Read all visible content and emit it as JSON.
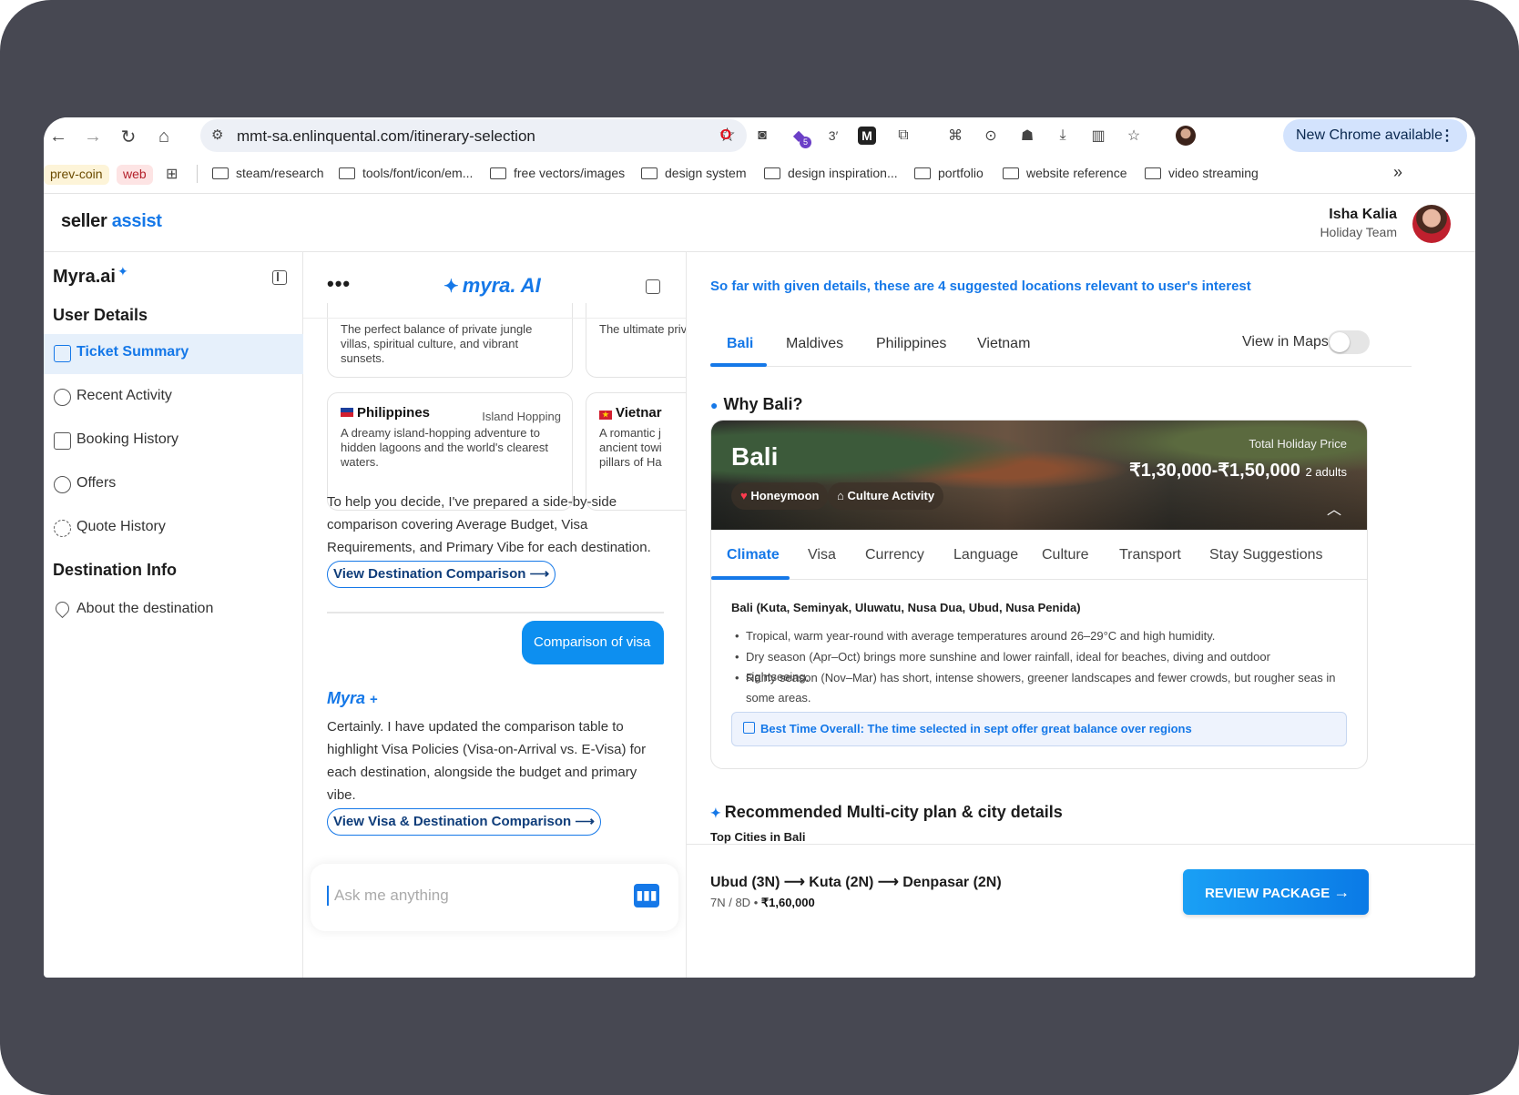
{
  "browser": {
    "url": "mmt-sa.enlinquental.com/itinerary-selection",
    "new_chrome": "New Chrome available",
    "ext_badge": "5",
    "ext_timer": "3′",
    "chips": [
      "prev-coin",
      "web"
    ],
    "bookmarks": [
      "steam/research",
      "tools/font/icon/em...",
      "free vectors/images",
      "design system",
      "design inspiration...",
      "portfolio",
      "website reference",
      "video streaming"
    ],
    "more": "»"
  },
  "app": {
    "logo_seller": "seller",
    "logo_assist": "assist",
    "user_name": "Isha Kalia",
    "user_team": "Holiday Team"
  },
  "sidebar": {
    "title": "Myra.ai",
    "section1": "User Details",
    "items": [
      "Ticket Summary",
      "Recent Activity",
      "Booking History",
      "Offers",
      "Quote History"
    ],
    "section2": "Destination Info",
    "items2": [
      "About the destination"
    ]
  },
  "chat": {
    "brand": "myra. AI",
    "brand_spark": "✦",
    "cards_top": [
      {
        "text": "The perfect balance of private jungle villas, spiritual culture, and vibrant sunsets."
      },
      {
        "text": "The ultimate private over lagoons."
      }
    ],
    "cards": [
      {
        "name": "Philippines",
        "tag": "Island Hopping",
        "text": "A dreamy island-hopping adventure to hidden lagoons and the world's clearest waters."
      },
      {
        "name": "Vietnar",
        "text": "A romantic j ancient towi pillars of Ha"
      }
    ],
    "msg1": "To help you decide, I've prepared a side-by-side comparison covering Average Budget, Visa Requirements, and Primary Vibe for each destination.",
    "link1": "View Destination Comparison ⟶",
    "user_msg": "Comparison of visa",
    "myra_label": "Myra",
    "myra_spark": "+",
    "msg2": "Certainly. I have updated the comparison table to highlight Visa Policies (Visa-on-Arrival vs. E-Visa) for each destination, alongside the budget and primary vibe.",
    "link2": "View Visa & Destination Comparison ⟶",
    "input_placeholder": "Ask me anything"
  },
  "right": {
    "headline": "So far with given details, these are 4 suggested locations relevant to user's interest",
    "tabs": [
      "Bali",
      "Maldives",
      "Philippines",
      "Vietnam"
    ],
    "view_maps": "View in Maps",
    "why": "Why Bali?",
    "hero": {
      "name": "Bali",
      "pill1": "Honeymoon",
      "pill2": "Culture Activity",
      "price_label": "Total Holiday Price",
      "price": "₹1,30,000-₹1,50,000",
      "adults": "2 adults"
    },
    "detail_tabs": [
      "Climate",
      "Visa",
      "Currency",
      "Language",
      "Culture",
      "Transport",
      "Stay Suggestions"
    ],
    "region": "Bali (Kuta, Seminyak, Uluwatu, Nusa Dua, Ubud, Nusa Penida)",
    "bullets": [
      "Tropical, warm year-round with average temperatures around 26–29°C and high humidity.",
      "Dry season (Apr–Oct) brings more sunshine and lower rainfall, ideal for beaches, diving and outdoor sightseeing.",
      "Rainy season (Nov–Mar) has short, intense showers, greener landscapes and fewer crowds, but rougher seas in some areas."
    ],
    "best_time": "Best Time Overall: The time selected in sept offer great balance over regions",
    "rec_title": "Recommended Multi-city plan & city details",
    "top_cities": "Top Cities in Bali",
    "route": "Ubud (3N) ⟶ Kuta (2N) ⟶ Denpasar (2N)",
    "duration": "7N / 8D",
    "total": "₹1,60,000",
    "review": "REVIEW PACKAGE"
  },
  "colors": {
    "accent": "#1578e8",
    "frame": "#474852",
    "bubble": "#0d8ff0"
  }
}
